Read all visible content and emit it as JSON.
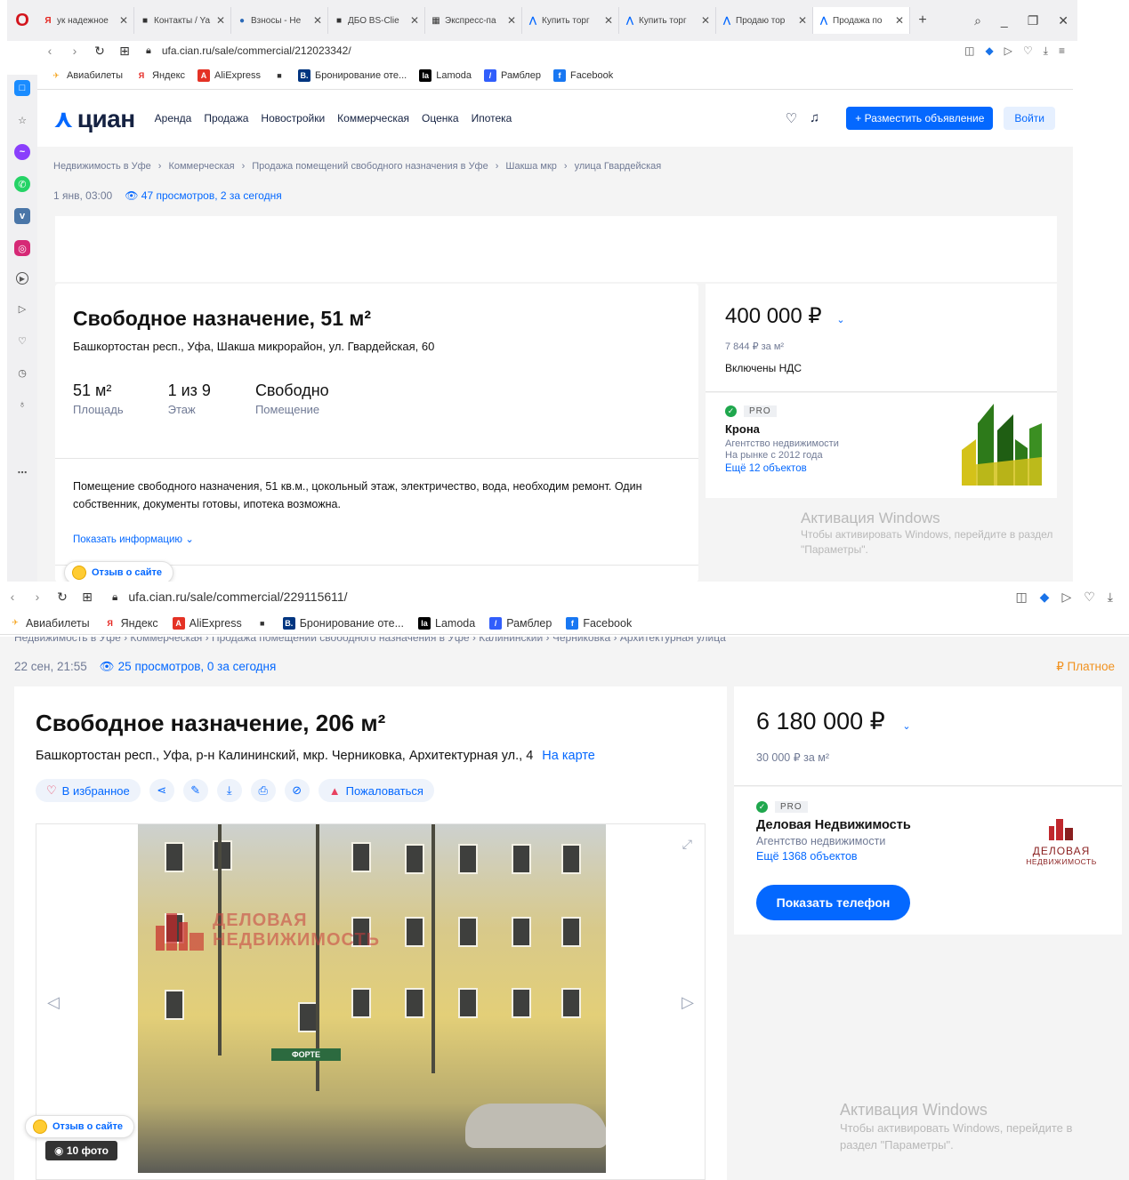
{
  "win1": {
    "tabs": [
      {
        "label": "ук надежное",
        "fav": "Я",
        "color": "#e52620"
      },
      {
        "label": "Контакты / Ya",
        "fav": "■",
        "color": "#333333"
      },
      {
        "label": "Взносы - Не",
        "fav": "●",
        "color": "#2c6ab8"
      },
      {
        "label": "ДБО BS-Clie",
        "fav": "■",
        "color": "#333333"
      },
      {
        "label": "Экспресс-па",
        "fav": "▦",
        "color": "#333333"
      },
      {
        "label": "Купить торг",
        "fav": "⋀",
        "color": "#0468ff"
      },
      {
        "label": "Купить торг",
        "fav": "⋀",
        "color": "#0468ff"
      },
      {
        "label": "Продаю тор",
        "fav": "⋀",
        "color": "#0468ff"
      },
      {
        "label": "Продажа по",
        "fav": "⋀",
        "color": "#0468ff"
      }
    ],
    "url": "ufa.cian.ru/sale/commercial/212023342/",
    "bookmarks": [
      {
        "label": "Авиабилеты",
        "icon": "✈",
        "color": "#f5a623"
      },
      {
        "label": "Яндекс",
        "icon": "Я",
        "color": "#e52620"
      },
      {
        "label": "AliExpress",
        "icon": "A",
        "color": "#e43225"
      },
      {
        "label": "",
        "icon": "■",
        "color": "#333333"
      },
      {
        "label": "Бронирование оте...",
        "icon": "B.",
        "color": "#003580"
      },
      {
        "label": "Lamoda",
        "icon": "la",
        "color": "#000000"
      },
      {
        "label": "Рамблер",
        "icon": "/",
        "color": "#315efb"
      },
      {
        "label": "Facebook",
        "icon": "f",
        "color": "#1877f2"
      }
    ],
    "cian": {
      "logo": "циан",
      "nav": [
        "Аренда",
        "Продажа",
        "Новостройки",
        "Коммерческая",
        "Оценка",
        "Ипотека"
      ],
      "post_button": "+ Разместить объявление",
      "login_button": "Войти"
    },
    "breadcrumbs": [
      "Недвижимость в Уфе",
      "›",
      "Коммерческая",
      "›",
      "Продажа помещений свободного назначения в Уфе",
      "›",
      "Шакша мкр",
      "›",
      "улица Гвардейская"
    ],
    "date": "1 янв, 03:00",
    "views": "47 просмотров, 2 за сегодня",
    "title": "Свободное назначение, 51 м²",
    "address": "Башкортостан респ., Уфа, Шакша микрорайон, ул. Гвардейская, 60",
    "facts": [
      {
        "value": "51 м²",
        "label": "Площадь"
      },
      {
        "value": "1 из 9",
        "label": "Этаж"
      },
      {
        "value": "Свободно",
        "label": "Помещение"
      }
    ],
    "description": "Помещение свободного назначения, 51 кв.м., цокольный этаж, электричество, вода, необходим ремонт. Один собственник, документы готовы, ипотека возможна.",
    "show_more": "Показать информацию ⌄",
    "review": "Отзыв о сайте",
    "price": "400 000 ₽",
    "price_per_m": "7 844 ₽ за м²",
    "vat": "Включены НДС",
    "agent": {
      "pro": "PRO",
      "name": "Крона",
      "type": "Агентство недвижимости",
      "since": "На рынке с 2012 года",
      "more": "Ещё 12 объектов"
    },
    "watermark": {
      "title": "Активация Windows",
      "text": "Чтобы активировать Windows, перейдите в раздел \"Параметры\"."
    }
  },
  "win2": {
    "url": "ufa.cian.ru/sale/commercial/229115611/",
    "bookmarks": [
      {
        "label": "Авиабилеты",
        "icon": "✈",
        "color": "#f5a623"
      },
      {
        "label": "Яндекс",
        "icon": "Я",
        "color": "#e52620"
      },
      {
        "label": "AliExpress",
        "icon": "A",
        "color": "#e43225"
      },
      {
        "label": "",
        "icon": "■",
        "color": "#333333"
      },
      {
        "label": "Бронирование оте...",
        "icon": "B.",
        "color": "#003580"
      },
      {
        "label": "Lamoda",
        "icon": "la",
        "color": "#000000"
      },
      {
        "label": "Рамблер",
        "icon": "/",
        "color": "#315efb"
      },
      {
        "label": "Facebook",
        "icon": "f",
        "color": "#1877f2"
      }
    ],
    "breadcrumbs": "Недвижимость в Уфе › Коммерческая › Продажа помещений свободного назначения в Уфе › Калининский › Черниковка › Архитектурная улица",
    "date": "22 сен, 21:55",
    "views": "25 просмотров, 0 за сегодня",
    "paid": "₽ Платное",
    "title": "Свободное назначение, 206 м²",
    "address": "Башкортостан респ., Уфа, р-н Калининский, мкр. Черниковка, Архитектурная ул., 4",
    "map_link": "На карте",
    "favorite": "В избранное",
    "complain": "Пожаловаться",
    "photo_sign": "ФОРТЕ",
    "photo_watermark": "ДЕЛОВАЯ НЕДВИЖИМОСТЬ",
    "photos_count": "10 фото",
    "review": "Отзыв о сайте",
    "price": "6 180 000 ₽",
    "price_per_m": "30 000 ₽ за м²",
    "agent": {
      "pro": "PRO",
      "name": "Деловая Недвижимость",
      "type": "Агентство недвижимости",
      "more": "Ещё 1368 объектов",
      "logo_line1": "ДЕЛОВАЯ",
      "logo_line2": "НЕДВИЖИМОСТЬ"
    },
    "phone_button": "Показать телефон",
    "watermark": {
      "title": "Активация Windows",
      "text": "Чтобы активировать Windows, перейдите в раздел \"Параметры\"."
    }
  }
}
